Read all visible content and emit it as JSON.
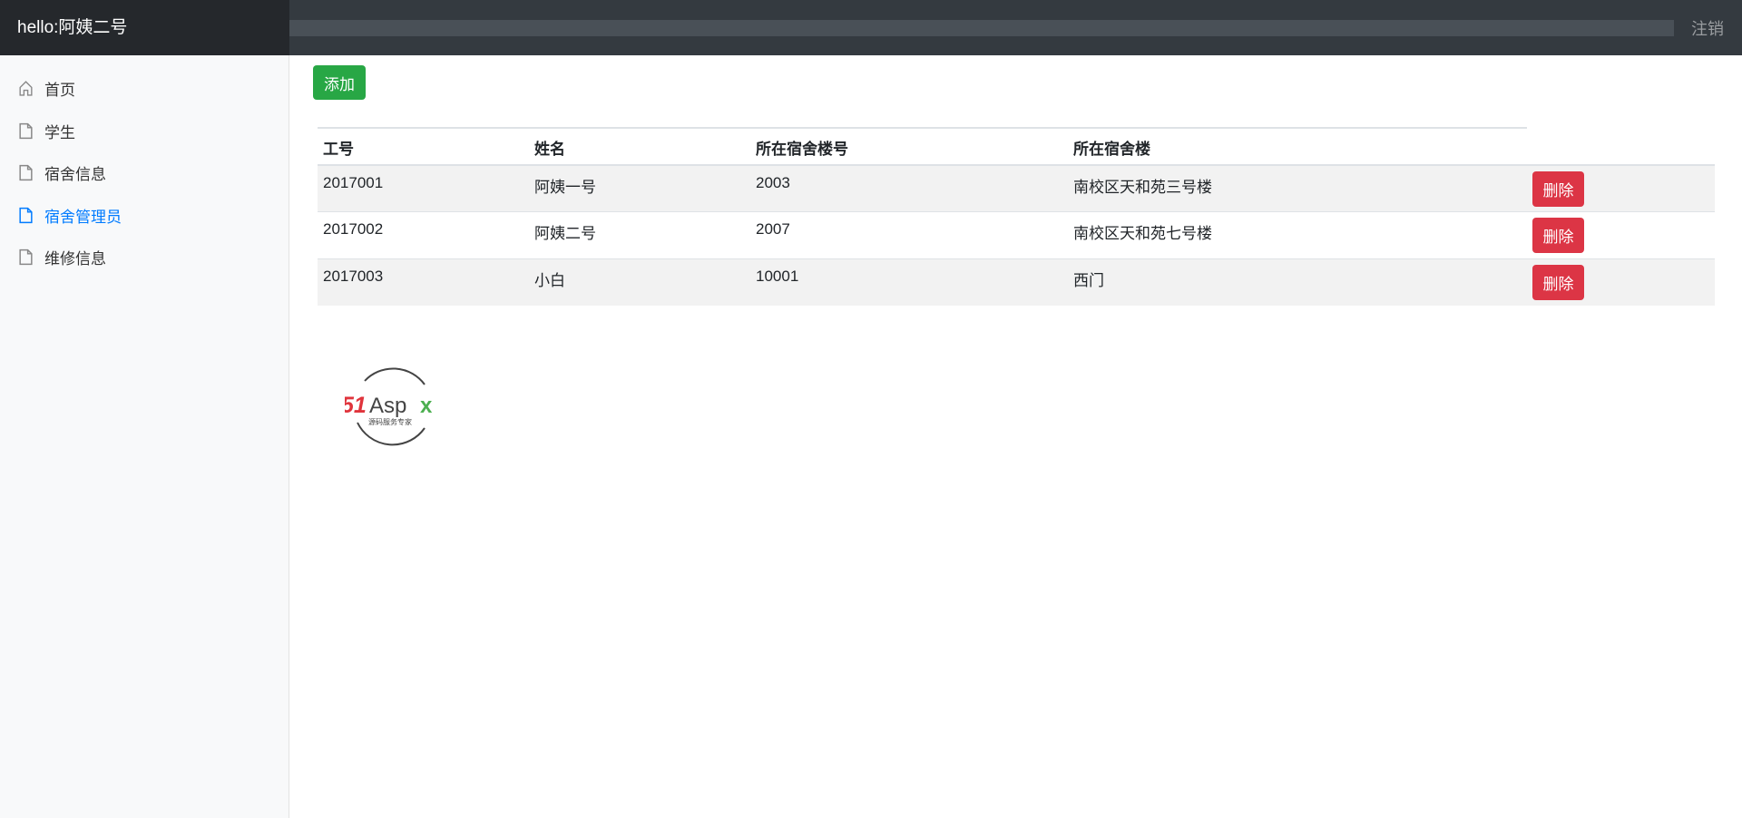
{
  "navbar": {
    "brand": "hello:阿姨二号",
    "search_placeholder": "",
    "logout": "注销"
  },
  "sidebar": {
    "items": [
      {
        "label": "首页",
        "icon": "home-icon",
        "active": false
      },
      {
        "label": "学生",
        "icon": "file-icon",
        "active": false
      },
      {
        "label": "宿舍信息",
        "icon": "file-icon",
        "active": false
      },
      {
        "label": "宿舍管理员",
        "icon": "file-icon",
        "active": true
      },
      {
        "label": "维修信息",
        "icon": "file-icon",
        "active": false
      }
    ]
  },
  "main": {
    "add_label": "添加",
    "columns": [
      "工号",
      "姓名",
      "所在宿舍楼号",
      "所在宿舍楼"
    ],
    "delete_label": "删除",
    "rows": [
      [
        "2017001",
        "阿姨一号",
        "2003",
        "南校区天和苑三号楼"
      ],
      [
        "2017002",
        "阿姨二号",
        "2007",
        "南校区天和苑七号楼"
      ],
      [
        "2017003",
        "小白",
        "10001",
        "西门"
      ]
    ]
  },
  "logo": {
    "text": "51Aspx",
    "subtitle": "源码服务专家"
  },
  "colors": {
    "accent": "#007bff",
    "add": "#28a745",
    "delete": "#dc3545",
    "navbar": "#343a40"
  }
}
